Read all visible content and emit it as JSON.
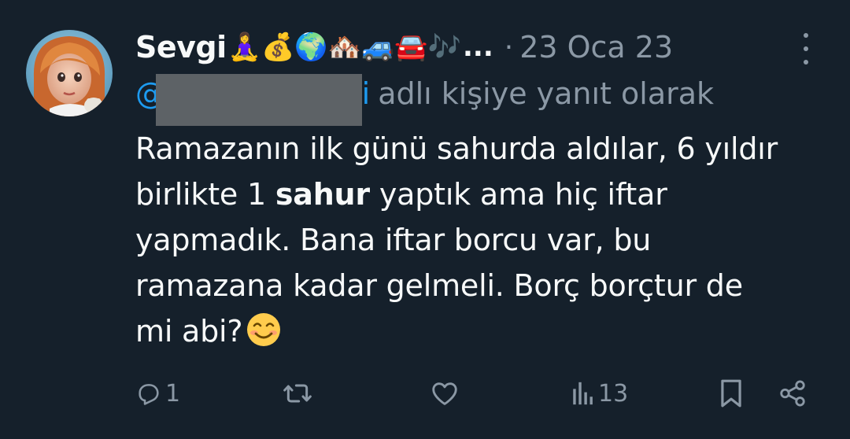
{
  "tweet": {
    "author": {
      "display_name": "Sevgi",
      "name_emojis": "🧘‍♀️💰🌍🏘️🚙🚘🎶",
      "name_ellipsis": "...",
      "avatar_icon": "avatar-photo"
    },
    "separator": "·",
    "timestamp": "23 Oca 23",
    "reply": {
      "at_sign": "@",
      "handle_tail": "ri",
      "suffix": "adlı kişiye yanıt olarak"
    },
    "body": {
      "line1": "Ramazanın ilk günü sahurda aldılar, 6 yıldır",
      "line2_pre": "birlikte 1 ",
      "line2_bold": "sahur",
      "line2_post": " yaptık ama hiç iftar",
      "line3": "yapmadık. Bana iftar borcu var, bu",
      "line4": "ramazana kadar gelmeli. Borç borçtur de",
      "line5": "mi abi?",
      "emoji_icon": "smiling-face-icon"
    },
    "actions": {
      "reply_count": "1",
      "retweet_count": "",
      "like_count": "",
      "views_count": "13"
    },
    "colors": {
      "background": "#15202b",
      "text": "#f7f9f9",
      "secondary": "#8b98a5",
      "link": "#1d9bf0"
    }
  }
}
